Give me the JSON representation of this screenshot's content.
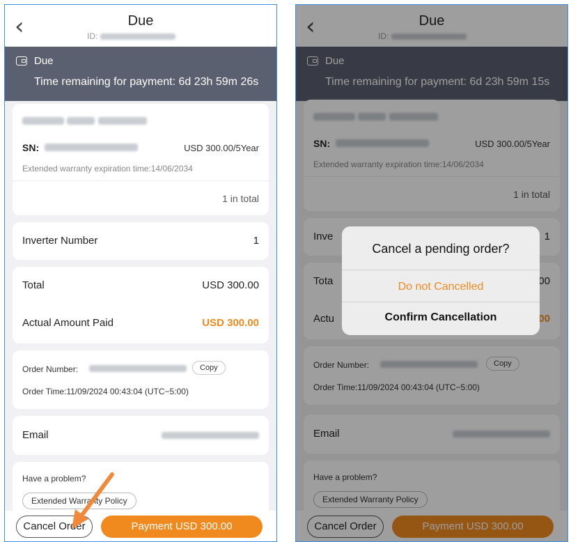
{
  "colors": {
    "accent": "#f08a1f",
    "banner_bg": "#5b6070",
    "page_bg": "#f1f1f3",
    "arrow": "#f08a3a"
  },
  "icons": {
    "back": "chevron-left-icon",
    "wallet": "wallet-icon"
  },
  "screens": [
    {
      "header": {
        "back_glyph": "‹",
        "title": "Due",
        "id_label": "ID:"
      },
      "banner": {
        "status": "Due",
        "time_remaining": "Time remaining for payment: 6d 23h 59m 26s"
      },
      "product": {
        "sn_label": "SN:",
        "price": "USD 300.00/5Year",
        "expiry": "Extended warranty expiration time:14/06/2034",
        "total_count": "1 in total"
      },
      "inverter": {
        "label": "Inverter Number",
        "value": "1"
      },
      "amounts": {
        "total_label": "Total",
        "total_value": "USD 300.00",
        "paid_label": "Actual Amount Paid",
        "paid_value": "USD 300.00"
      },
      "order": {
        "number_label": "Order Number:",
        "copy_label": "Copy",
        "time": "Order Time:11/09/2024 00:43:04 (UTC−5:00)"
      },
      "email": {
        "label": "Email"
      },
      "help": {
        "question": "Have a problem?",
        "policy_button": "Extended Warranty Policy"
      },
      "footer": {
        "cancel": "Cancel Order",
        "pay": "Payment USD 300.00"
      }
    },
    {
      "header": {
        "back_glyph": "‹",
        "title": "Due",
        "id_label": "ID:"
      },
      "banner": {
        "status": "Due",
        "time_remaining": "Time remaining for payment: 6d 23h 59m 15s"
      },
      "product": {
        "sn_label": "SN:",
        "price": "USD 300.00/5Year",
        "expiry": "Extended warranty expiration time:14/06/2034",
        "total_count": "1 in total"
      },
      "inverter": {
        "label": "Inve",
        "value": "1"
      },
      "amounts": {
        "total_label": "Tota",
        "total_value": "0.00",
        "paid_label": "Actu",
        "paid_value": "0.00"
      },
      "order": {
        "number_label": "Order Number:",
        "copy_label": "Copy",
        "time": "Order Time:11/09/2024 00:43:04 (UTC−5:00)"
      },
      "email": {
        "label": "Email"
      },
      "help": {
        "question": "Have a problem?",
        "policy_button": "Extended Warranty Policy"
      },
      "footer": {
        "cancel": "Cancel Order",
        "pay": "Payment USD 300.00"
      },
      "dialog": {
        "title": "Cancel a pending order?",
        "option_keep": "Do not Cancelled",
        "option_confirm": "Confirm Cancellation"
      }
    }
  ]
}
